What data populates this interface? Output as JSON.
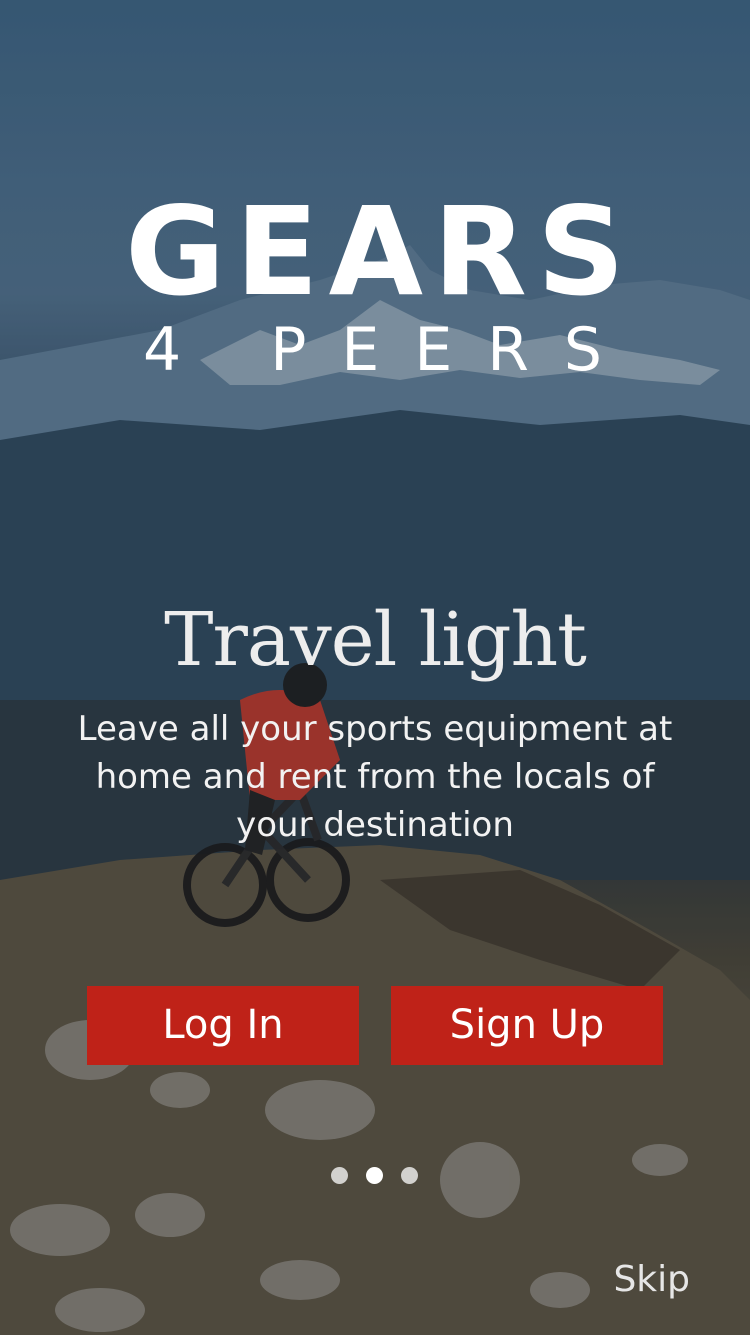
{
  "brand": {
    "name": "GEARS",
    "subline": "4 PEERS"
  },
  "slide": {
    "headline": "Travel light",
    "description": "Leave all your sports equipment at home and rent from the locals of your destination"
  },
  "actions": {
    "login_label": "Log In",
    "signup_label": "Sign Up",
    "skip_label": "Skip"
  },
  "pager": {
    "total": 3,
    "active_index": 1
  },
  "colors": {
    "button": "#bf2218",
    "text": "#ffffff",
    "sky": "#3d6483"
  }
}
